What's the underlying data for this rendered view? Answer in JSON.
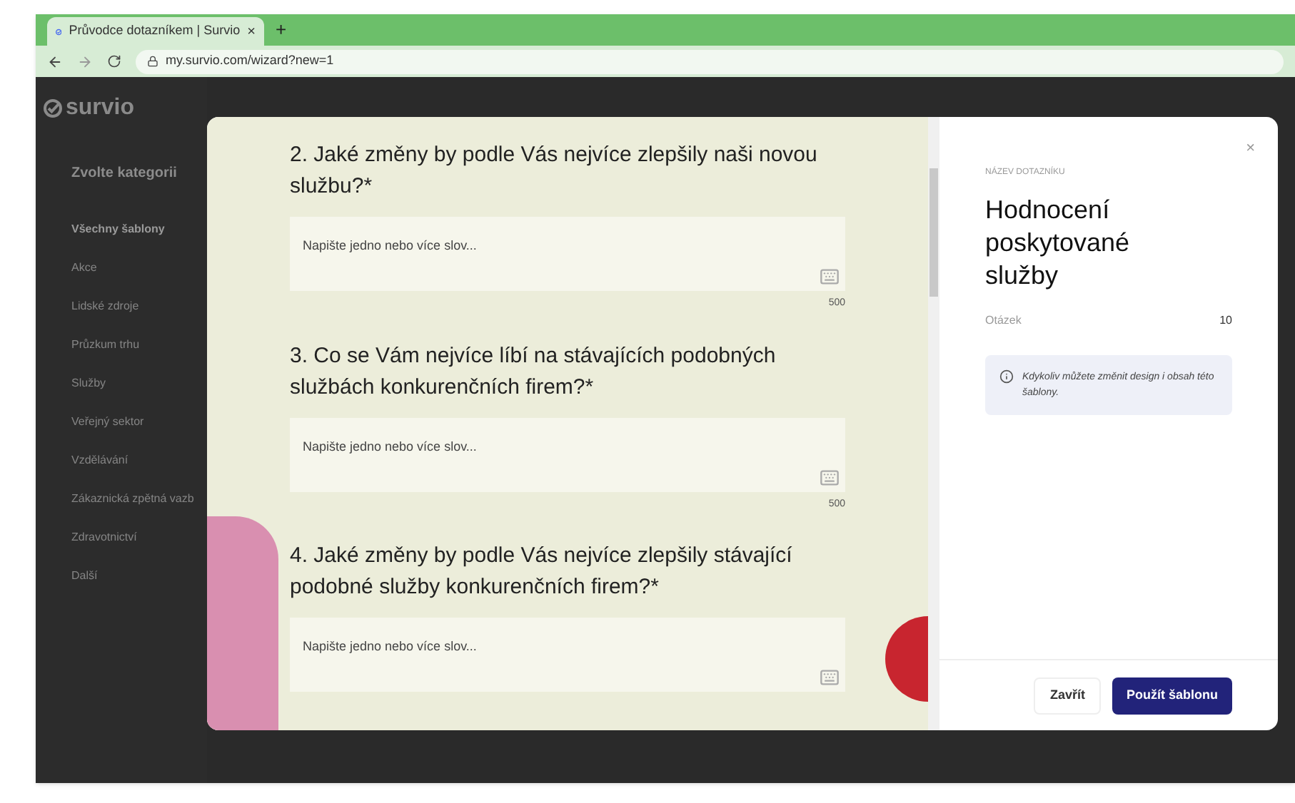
{
  "browser": {
    "tab": {
      "title": "Průvodce dotazníkem | Survio",
      "close": "×"
    },
    "new_tab": "+",
    "url": "my.survio.com/wizard?new=1"
  },
  "app": {
    "logo": "survio",
    "sidebar": {
      "title": "Zvolte kategorii",
      "items": [
        {
          "label": "Všechny šablony",
          "selected": true
        },
        {
          "label": "Akce",
          "selected": false
        },
        {
          "label": "Lidské zdroje",
          "selected": false
        },
        {
          "label": "Průzkum trhu",
          "selected": false
        },
        {
          "label": "Služby",
          "selected": false
        },
        {
          "label": "Veřejný sektor",
          "selected": false
        },
        {
          "label": "Vzdělávání",
          "selected": false
        },
        {
          "label": "Zákaznická zpětná vazb",
          "selected": false
        },
        {
          "label": "Zdravotnictví",
          "selected": false
        },
        {
          "label": "Další",
          "selected": false
        }
      ]
    }
  },
  "modal": {
    "questions": [
      {
        "title": "2. Jaké změny by podle Vás nejvíce zlepšily naši novou službu?*",
        "placeholder": "Napište jedno nebo více slov...",
        "limit": "500"
      },
      {
        "title": "3. Co se Vám nejvíce líbí na stávajících podobných službách konkurenčních firem?*",
        "placeholder": "Napište jedno nebo více slov...",
        "limit": "500"
      },
      {
        "title": "4. Jaké změny by podle Vás nejvíce zlepšily stávající podobné služby konkurenčních firem?*",
        "placeholder": "Napište jedno nebo více slov..."
      }
    ],
    "panel": {
      "close": "×",
      "label": "NÁZEV DOTAZNÍKU",
      "name": "Hodnocení poskytované služby",
      "stat_label": "Otázek",
      "stat_value": "10",
      "info": "Kdykoliv můžete změnit design i obsah této šablony."
    },
    "buttons": [
      {
        "label": "Zavřít",
        "kind": "secondary"
      },
      {
        "label": "Použít šablonu",
        "kind": "primary"
      }
    ]
  }
}
